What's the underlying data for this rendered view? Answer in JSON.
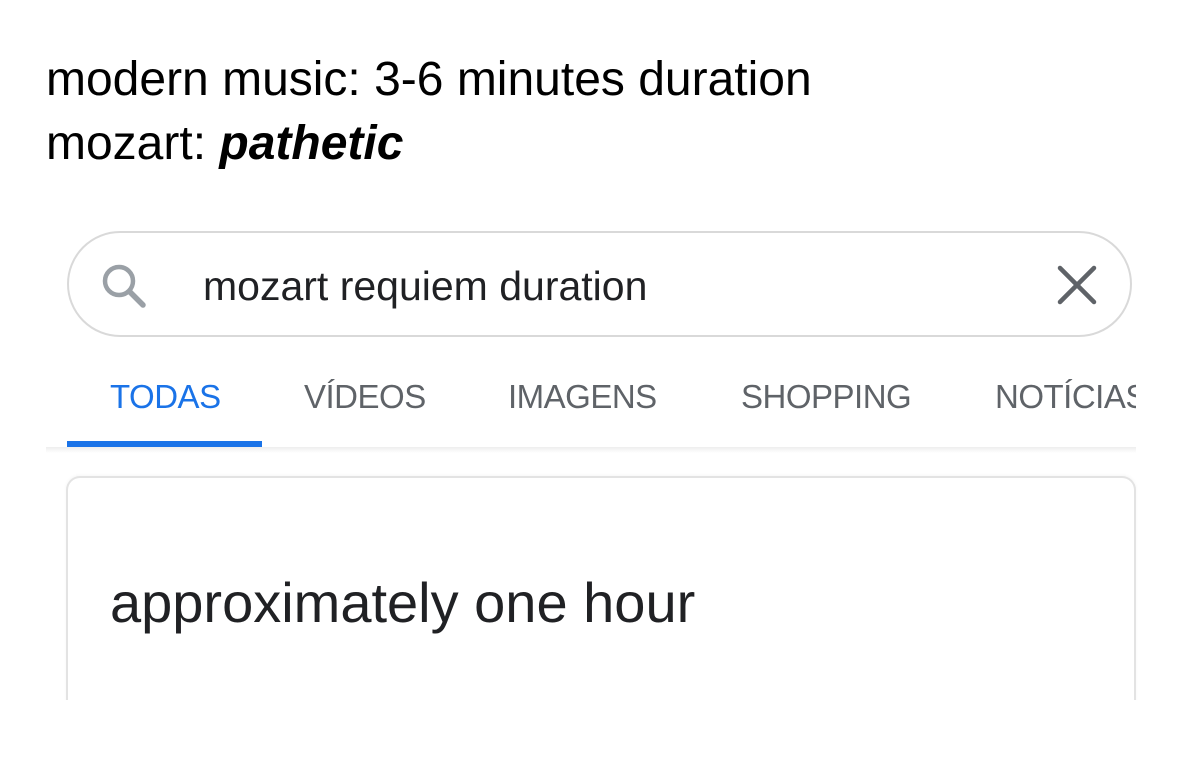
{
  "caption": {
    "line1": "modern music: 3-6 minutes duration",
    "line2_prefix": "mozart: ",
    "line2_emphasis": "pathetic"
  },
  "search": {
    "value": "mozart requiem duration",
    "search_icon": "search-icon",
    "clear_icon": "close-icon"
  },
  "tabs": [
    {
      "label": "TODAS",
      "active": true
    },
    {
      "label": "VÍDEOS",
      "active": false
    },
    {
      "label": "IMAGENS",
      "active": false
    },
    {
      "label": "SHOPPING",
      "active": false
    },
    {
      "label": "NOTÍCIAS",
      "active": false
    }
  ],
  "result": {
    "answer": "approximately one hour"
  },
  "colors": {
    "accent": "#1a73e8",
    "tab_inactive": "#5f6368",
    "text": "#202124",
    "border": "#d9d9d9"
  }
}
